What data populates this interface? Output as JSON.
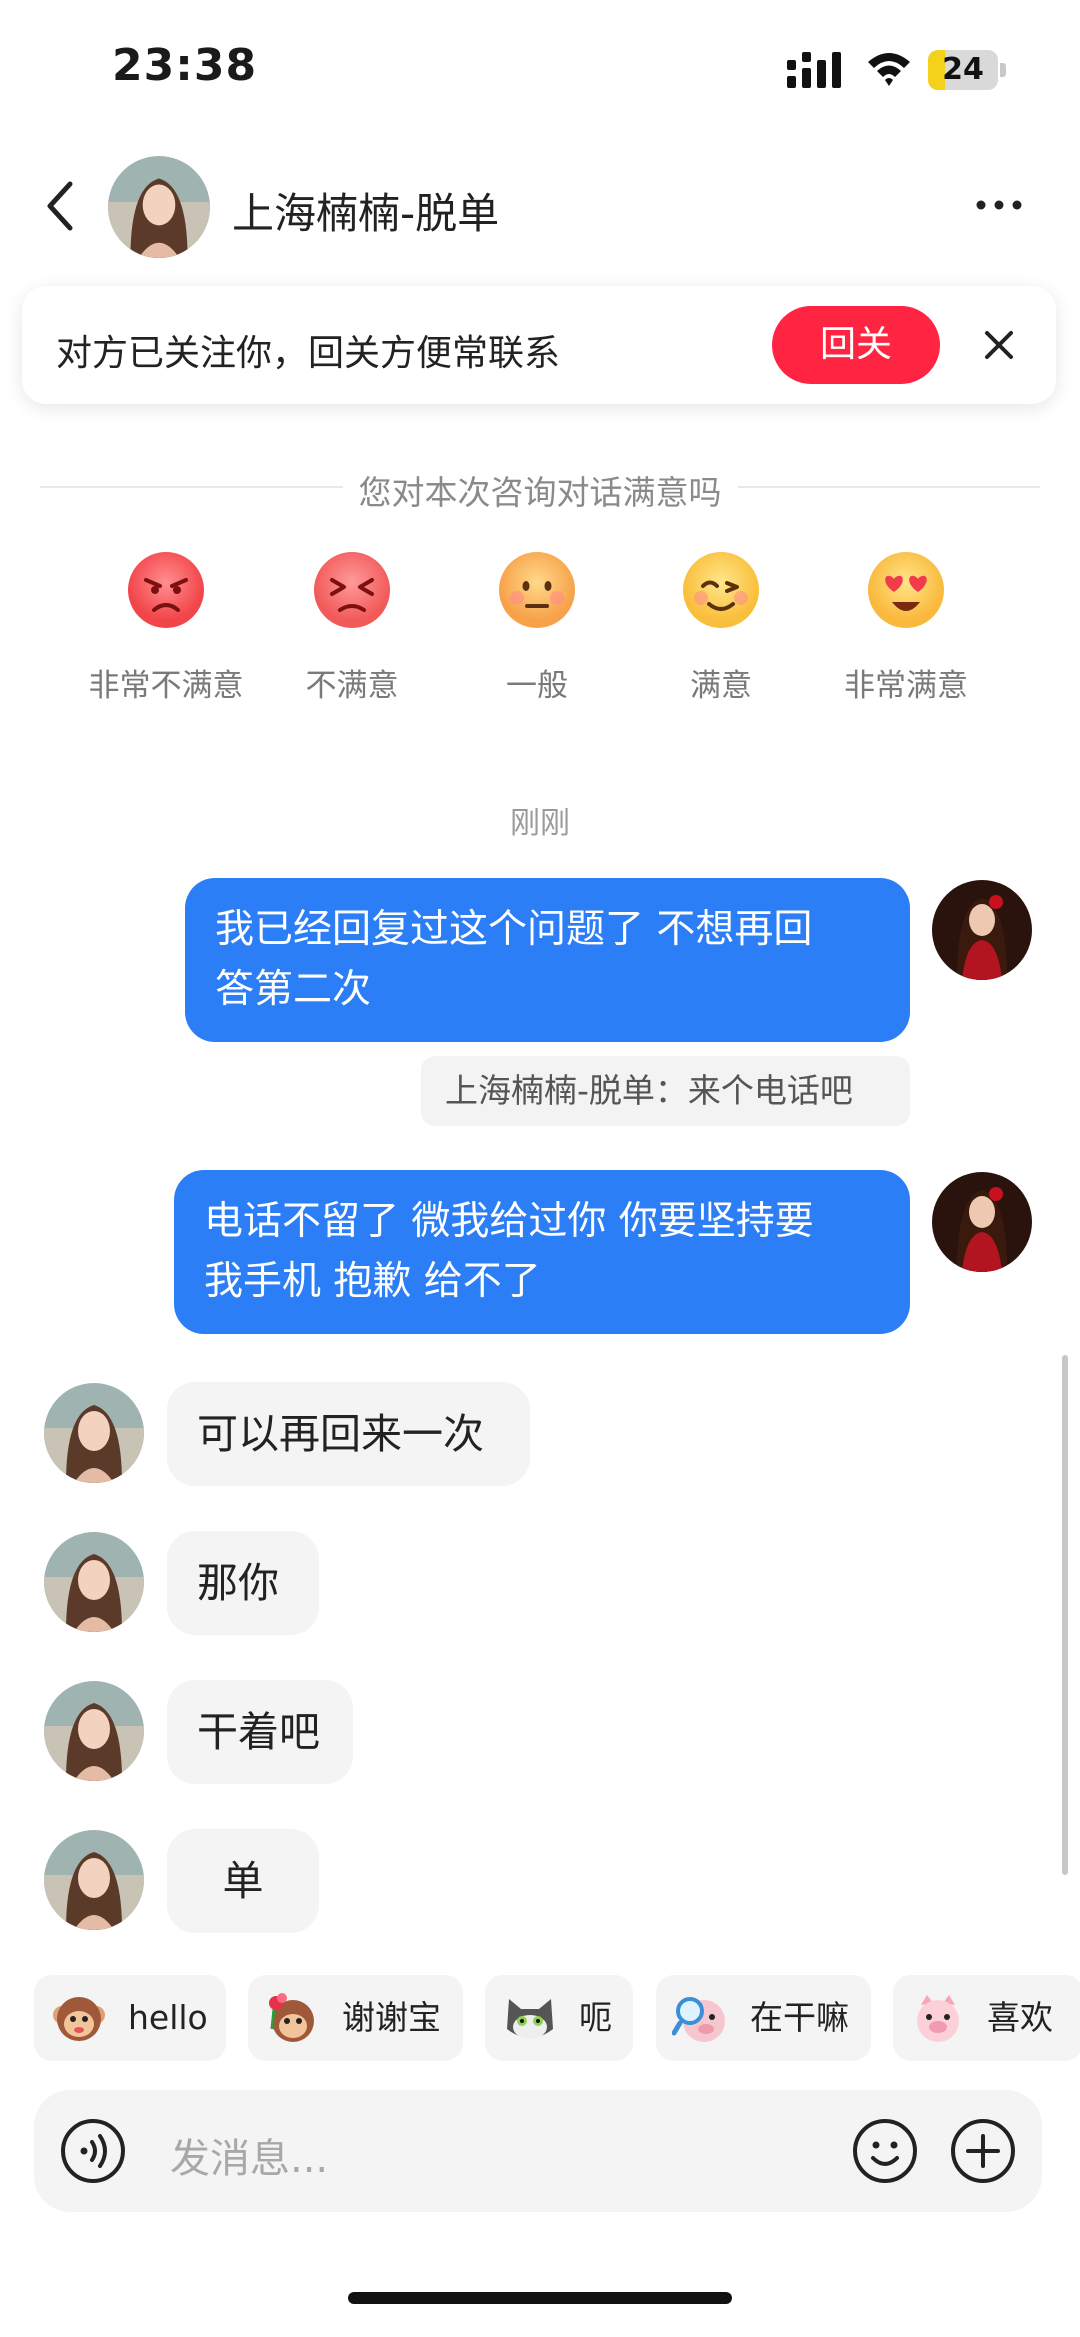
{
  "status_bar": {
    "time": "23:38",
    "battery": "24",
    "battery_level": 0.24,
    "icons": [
      "signal-icon",
      "wifi-icon",
      "battery-icon"
    ]
  },
  "header": {
    "contact_name": "上海楠楠-脱单",
    "back_icon": "chevron-left-icon",
    "more_icon": "more-icon"
  },
  "follow_banner": {
    "text": "对方已关注你，回关方便常联系",
    "button": "回关",
    "close_icon": "close-icon",
    "button_color": "#ff2442"
  },
  "survey": {
    "title": "您对本次咨询对话满意吗",
    "options": [
      {
        "label": "非常不满意",
        "icon": "very-angry-face-icon"
      },
      {
        "label": "不满意",
        "icon": "annoyed-face-icon"
      },
      {
        "label": "一般",
        "icon": "neutral-face-icon"
      },
      {
        "label": "满意",
        "icon": "smile-face-icon"
      },
      {
        "label": "非常满意",
        "icon": "heart-eyes-face-icon"
      }
    ]
  },
  "timestamp": "刚刚",
  "messages": [
    {
      "side": "out",
      "lines": [
        "我已经回复过这个问题了 不想再回",
        "答第二次"
      ]
    },
    {
      "side": "quote",
      "text": "上海楠楠-脱单：来个电话吧"
    },
    {
      "side": "out",
      "lines": [
        "电话不留了 微我给过你 你要坚持要",
        "我手机 抱歉 给不了"
      ]
    },
    {
      "side": "in",
      "text": "可以再回来一次"
    },
    {
      "side": "in",
      "text": "那你"
    },
    {
      "side": "in",
      "text": "干着吧"
    },
    {
      "side": "in",
      "text": "单"
    }
  ],
  "stickers": [
    {
      "label": "hello",
      "icon": "monkey-hello-icon"
    },
    {
      "label": "谢谢宝",
      "icon": "monkey-flower-icon"
    },
    {
      "label": "呃",
      "icon": "cat-icon"
    },
    {
      "label": "在干嘛",
      "icon": "magnifier-pig-icon"
    },
    {
      "label": "喜欢",
      "icon": "pig-icon"
    }
  ],
  "input": {
    "placeholder": "发消息...",
    "voice_icon": "voice-icon",
    "emoji_icon": "emoji-icon",
    "plus_icon": "plus-icon"
  },
  "colors": {
    "outgoing_bubble": "#2b7ef5",
    "incoming_bubble": "#f4f4f4",
    "accent": "#ff2442"
  }
}
